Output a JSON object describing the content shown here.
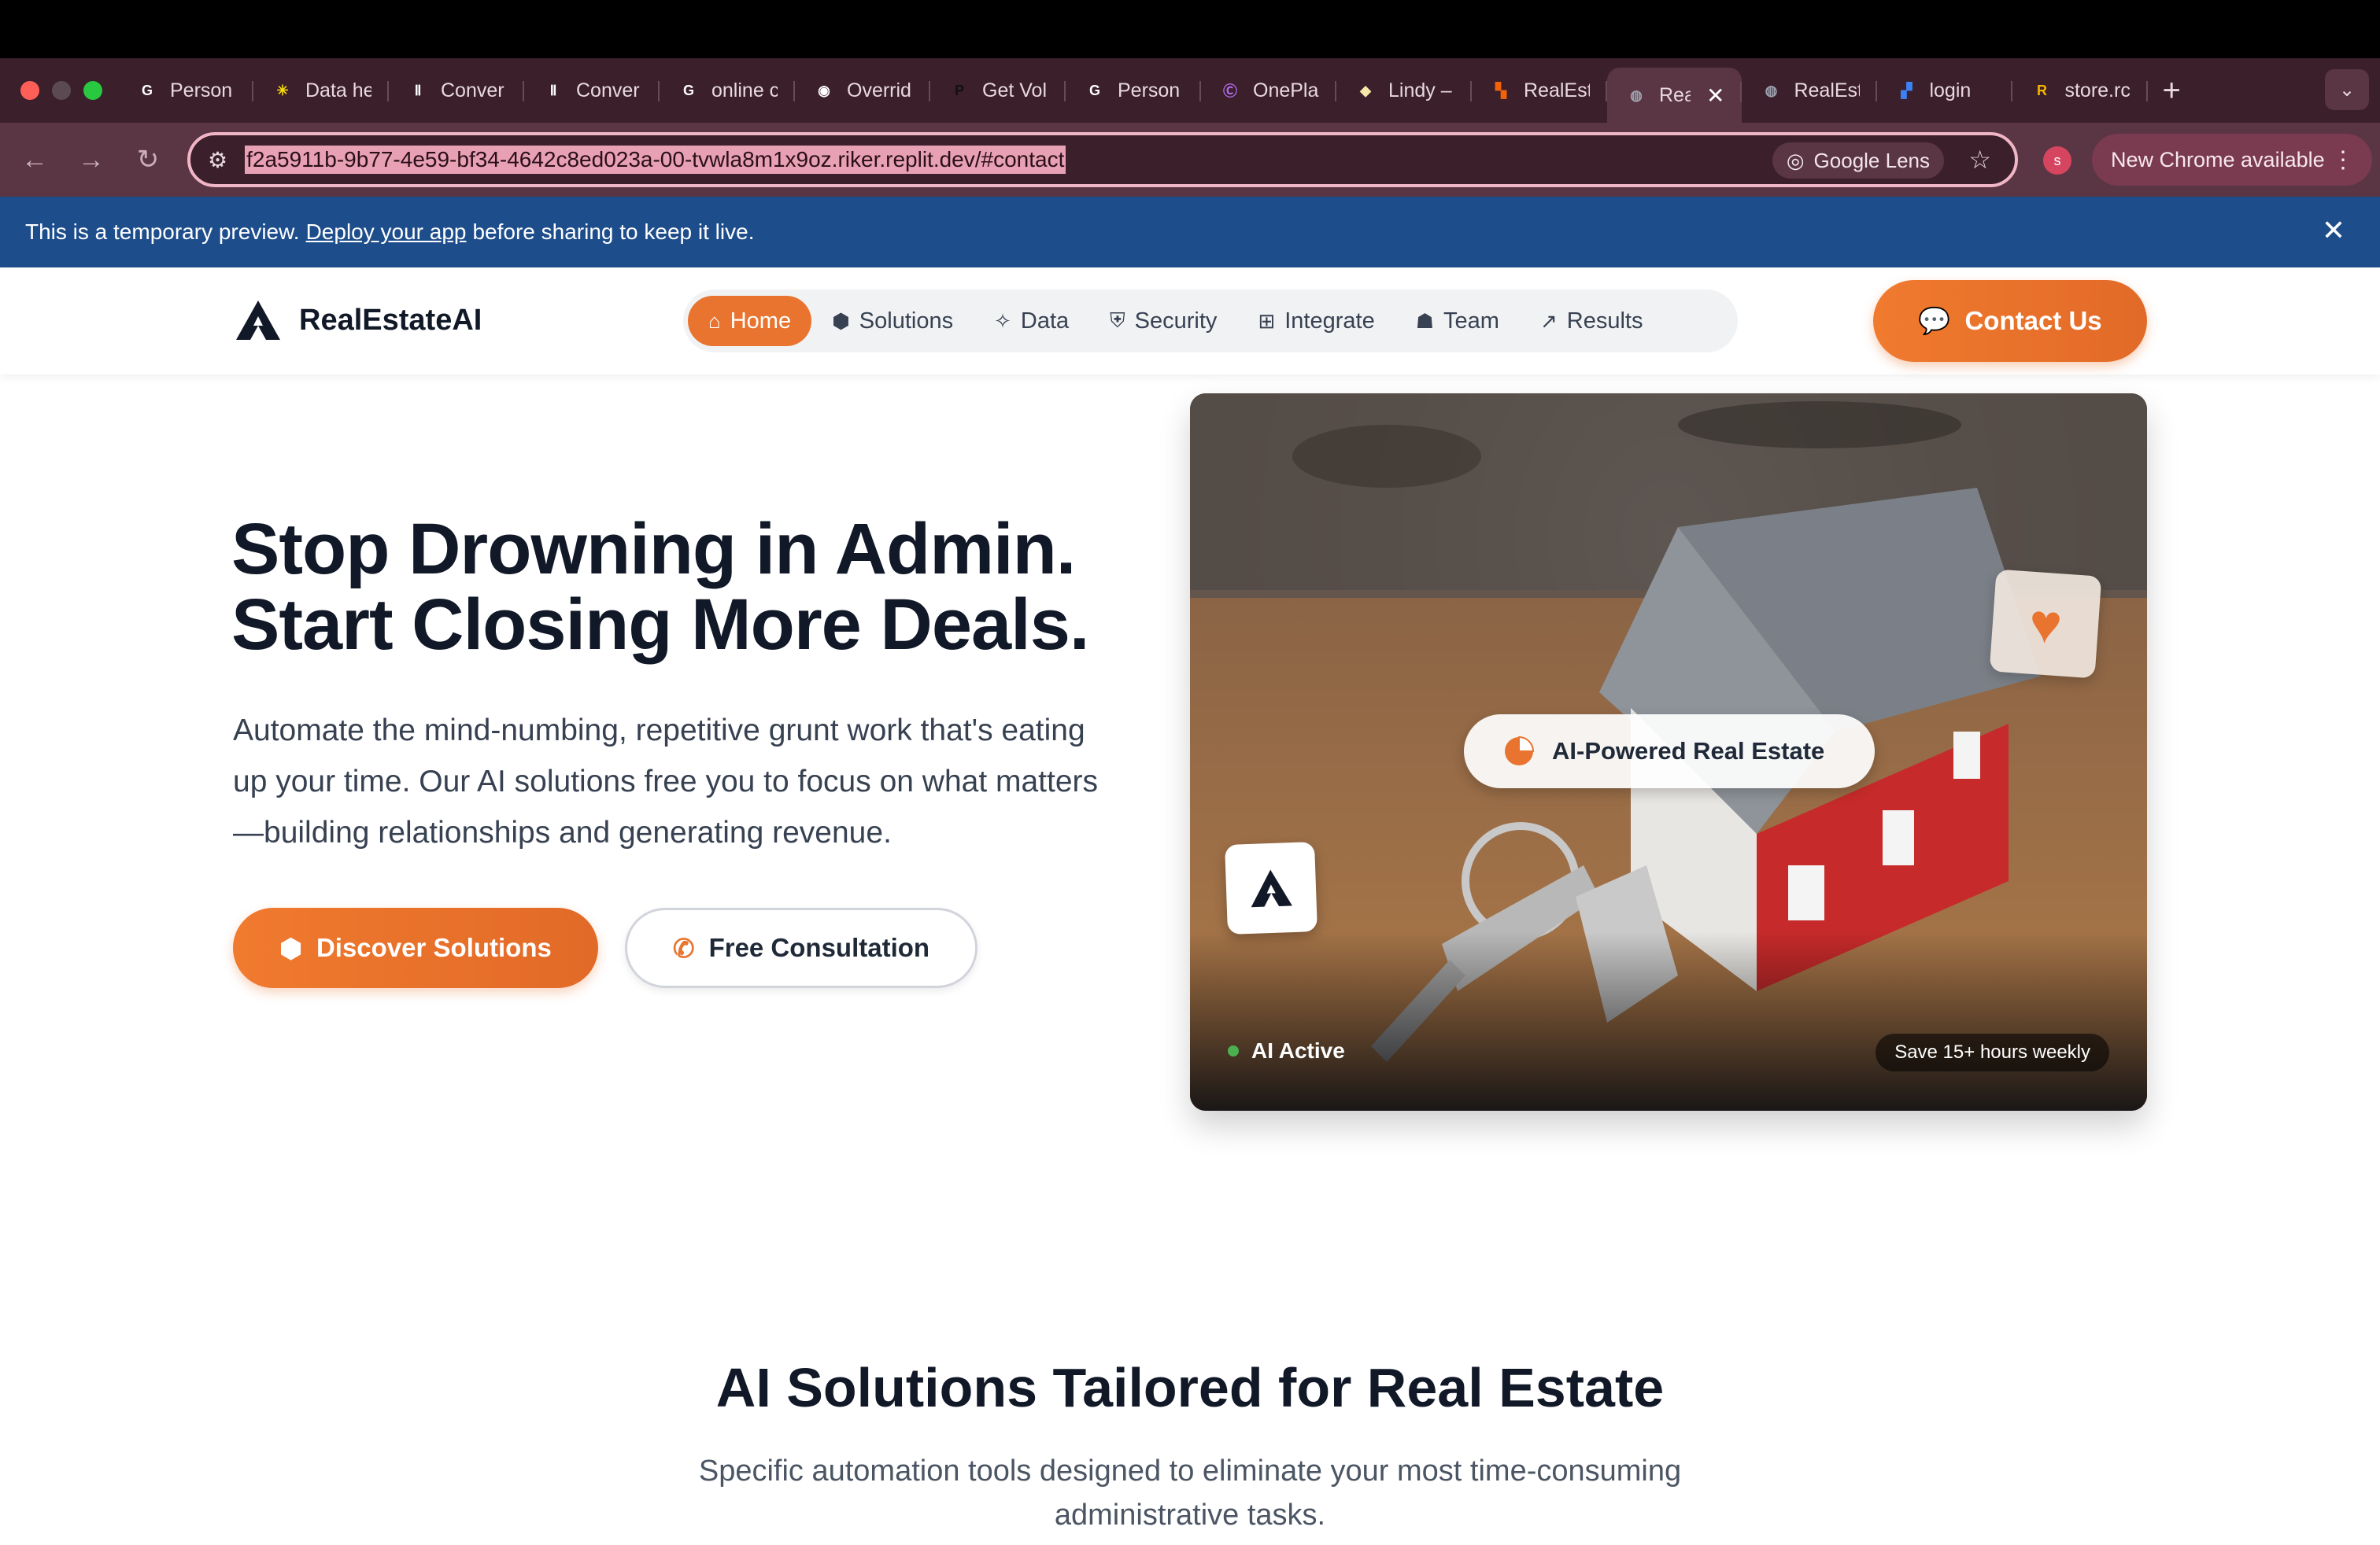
{
  "browser": {
    "tabs": [
      {
        "label": "Person",
        "icon": "google-icon",
        "color": "#ffffff",
        "glyph": "G"
      },
      {
        "label": "Data he",
        "icon": "data-icon",
        "color": "#f5d90a",
        "glyph": "✳"
      },
      {
        "label": "Conver",
        "icon": "convert-icon",
        "color": "#ffffff",
        "glyph": "Ⅱ"
      },
      {
        "label": "Conver",
        "icon": "convert-icon",
        "color": "#ffffff",
        "glyph": "Ⅱ"
      },
      {
        "label": "online c",
        "icon": "google-icon",
        "color": "#ffffff",
        "glyph": "G"
      },
      {
        "label": "Overrid",
        "icon": "override-icon",
        "color": "#ffffff",
        "glyph": "◉"
      },
      {
        "label": "Get Vol",
        "icon": "p-icon",
        "color": "#111111",
        "glyph": "P"
      },
      {
        "label": "Person",
        "icon": "google-icon",
        "color": "#ffffff",
        "glyph": "G"
      },
      {
        "label": "OnePla",
        "icon": "oneplace-icon",
        "color": "#b46cf0",
        "glyph": "Ⓒ"
      },
      {
        "label": "Lindy –",
        "icon": "lindy-icon",
        "color": "#f9e7a8",
        "glyph": "◆"
      },
      {
        "label": "RealEst",
        "icon": "replit-icon",
        "color": "#f26207",
        "glyph": "▚"
      },
      {
        "label": "Rea",
        "icon": "globe-icon",
        "color": "#9ca3af",
        "glyph": "◍",
        "active": true
      },
      {
        "label": "RealEst",
        "icon": "globe-icon",
        "color": "#9ca3af",
        "glyph": "◍"
      },
      {
        "label": "login",
        "icon": "login-icon",
        "color": "#3b82f6",
        "glyph": "▞"
      },
      {
        "label": "store.rc",
        "icon": "store-icon",
        "color": "#f5b400",
        "glyph": "R"
      }
    ],
    "url": "f2a5911b-9b77-4e59-bf34-4642c8ed023a-00-tvwla8m1x9oz.riker.replit.dev/#contact",
    "lens_label": "Google Lens",
    "profile_initial": "s",
    "new_chrome_label": "New Chrome available"
  },
  "banner": {
    "text_before": "This is a temporary preview.",
    "link": "Deploy your app",
    "text_after": "before sharing to keep it live."
  },
  "header": {
    "brand": "RealEstateAI",
    "nav": [
      {
        "label": "Home",
        "icon": "home-icon",
        "glyph": "⌂",
        "active": true
      },
      {
        "label": "Solutions",
        "icon": "cube-icon",
        "glyph": "⬢"
      },
      {
        "label": "Data",
        "icon": "pointer-icon",
        "glyph": "✧"
      },
      {
        "label": "Security",
        "icon": "shield-icon",
        "glyph": "⛨"
      },
      {
        "label": "Integrate",
        "icon": "chip-icon",
        "glyph": "⊞"
      },
      {
        "label": "Team",
        "icon": "users-icon",
        "glyph": "☗"
      },
      {
        "label": "Results",
        "icon": "trend-icon",
        "glyph": "↗"
      }
    ],
    "contact_label": "Contact Us"
  },
  "hero": {
    "title_line1": "Stop Drowning in Admin.",
    "title_line2": "Start Closing More Deals.",
    "text": "Automate the mind-numbing, repetitive grunt work that's eating up your time. Our AI solutions free you to focus on what matters—building relationships and generating revenue.",
    "primary_label": "Discover Solutions",
    "secondary_label": "Free Consultation",
    "card": {
      "pill_label": "AI-Powered Real Estate",
      "status_label": "AI Active",
      "save_label": "Save 15+ hours weekly"
    }
  },
  "section": {
    "title": "AI Solutions Tailored for Real Estate",
    "subtitle": "Specific automation tools designed to eliminate your most time-consuming administrative tasks."
  },
  "colors": {
    "accent": "#e8742f",
    "banner": "#1e4d8c",
    "tabstrip": "#3b1f2b"
  }
}
